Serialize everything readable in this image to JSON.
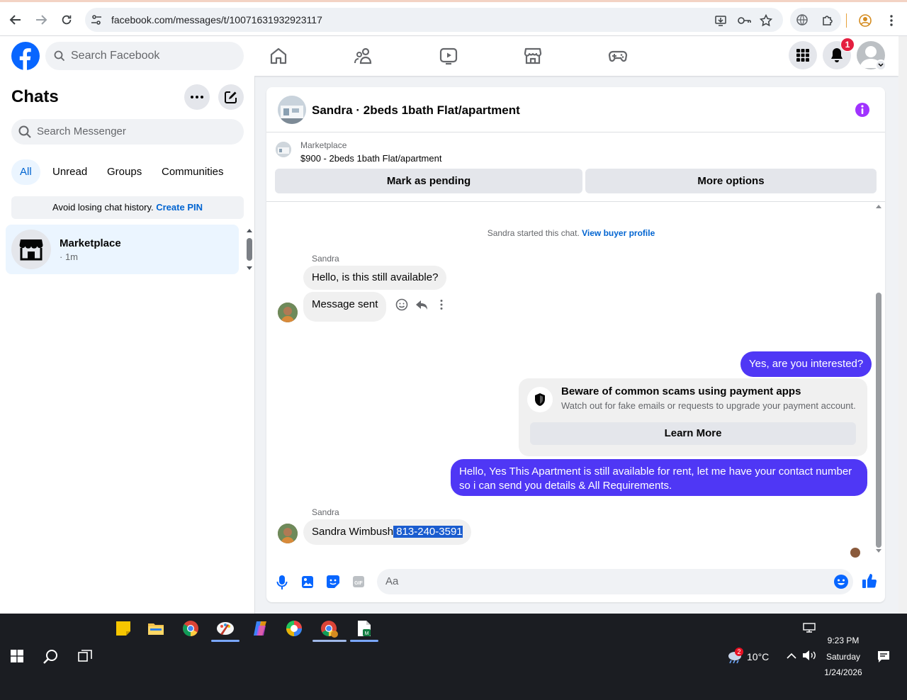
{
  "browser": {
    "url": "facebook.com/messages/t/10071631932923117"
  },
  "header": {
    "search_placeholder": "Search Facebook",
    "notification_count": "1",
    "colors": {
      "brand": "#0866ff",
      "badge": "#e41e3f"
    }
  },
  "sidebar": {
    "title": "Chats",
    "search_placeholder": "Search Messenger",
    "filters": [
      "All",
      "Unread",
      "Groups",
      "Communities"
    ],
    "active_filter": "All",
    "pin_banner": {
      "text": "Avoid losing chat history.",
      "link": "Create PIN"
    },
    "chats": [
      {
        "name": "Marketplace",
        "time": "· 1m",
        "icon": "marketplace-store-icon"
      }
    ]
  },
  "conversation": {
    "title": "Sandra · 2beds 1bath Flat/apartment",
    "listing": {
      "label": "Marketplace",
      "description": "$900 - 2beds 1bath Flat/apartment",
      "primary_action": "Mark as pending",
      "secondary_action": "More options"
    },
    "system_note": {
      "text": "Sandra started this chat.",
      "link": "View buyer profile"
    },
    "messages": [
      {
        "sender": "Sandra",
        "direction": "in",
        "text": "Hello, is this still available?"
      },
      {
        "direction": "in",
        "text": "Message sent"
      },
      {
        "direction": "out",
        "text": "Yes, are you interested?"
      },
      {
        "direction": "out",
        "type": "card",
        "title": "Beware of common scams using payment apps",
        "subtitle": "Watch out for fake emails or requests to upgrade your payment account.",
        "button": "Learn More"
      },
      {
        "direction": "out",
        "text_line1": "Hello, Yes This Apartment is still available for rent, let me have your contact number",
        "text_line2": "so i can send you details & All Requirements."
      },
      {
        "sender": "Sandra",
        "direction": "in",
        "text_plain": "Sandra Wimbush",
        "text_highlighted": " 813-240-3591"
      }
    ],
    "composer": {
      "placeholder": "Aa"
    },
    "colors": {
      "outgoing": "#4f37f5",
      "incoming": "#f0f0f0",
      "info": "#a033ff",
      "highlight": "#1a5ccf"
    }
  },
  "taskbar": {
    "weather": {
      "temp": "10°C",
      "badge": "2"
    },
    "time": "9:23 PM",
    "day": "Saturday",
    "date": "1/24/2026"
  }
}
